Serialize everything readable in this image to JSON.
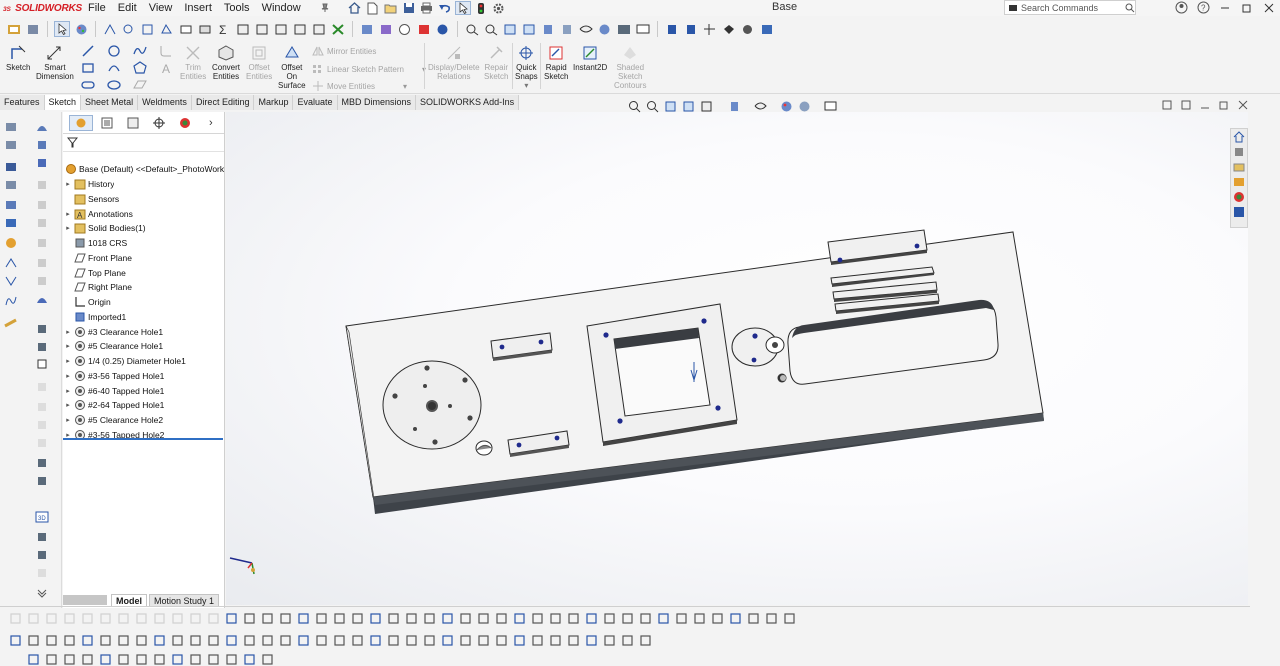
{
  "app": {
    "brand": "SOLIDWORKS",
    "document_title": "Base",
    "menu": [
      "File",
      "Edit",
      "View",
      "Insert",
      "Tools",
      "Window"
    ],
    "search_placeholder": "Search Commands"
  },
  "command_manager": {
    "sketch": "Sketch",
    "smart_dimension": [
      "Smart",
      "Dimension"
    ],
    "trim_entities": [
      "Trim",
      "Entities"
    ],
    "convert_entities": [
      "Convert",
      "Entities"
    ],
    "offset_entities": [
      "Offset",
      "Entities"
    ],
    "offset_on_surface": [
      "Offset",
      "On",
      "Surface"
    ],
    "mirror_entities": "Mirror Entities",
    "linear_sketch_pattern": "Linear Sketch Pattern",
    "move_entities": "Move Entities",
    "display_delete_relations": [
      "Display/Delete",
      "Relations"
    ],
    "repair_sketch": [
      "Repair",
      "Sketch"
    ],
    "quick_snaps": [
      "Quick",
      "Snaps"
    ],
    "rapid_sketch": [
      "Rapid",
      "Sketch"
    ],
    "instant2d": "Instant2D",
    "shaded_sketch_contours": [
      "Shaded",
      "Sketch",
      "Contours"
    ]
  },
  "tabs": [
    "Features",
    "Sketch",
    "Sheet Metal",
    "Weldments",
    "Direct Editing",
    "Markup",
    "Evaluate",
    "MBD Dimensions",
    "SOLIDWORKS Add-Ins"
  ],
  "active_tab": "Sketch",
  "feature_tree": {
    "root": "Base (Default) <<Default>_PhotoWorks Di",
    "items": [
      {
        "label": "History",
        "expandable": true,
        "icon": "history-icon"
      },
      {
        "label": "Sensors",
        "expandable": false,
        "icon": "sensors-icon"
      },
      {
        "label": "Annotations",
        "expandable": true,
        "icon": "annotations-icon"
      },
      {
        "label": "Solid Bodies(1)",
        "expandable": true,
        "icon": "solid-bodies-icon"
      },
      {
        "label": "1018 CRS",
        "expandable": false,
        "icon": "material-icon"
      },
      {
        "label": "Front Plane",
        "expandable": false,
        "icon": "plane-icon"
      },
      {
        "label": "Top Plane",
        "expandable": false,
        "icon": "plane-icon"
      },
      {
        "label": "Right Plane",
        "expandable": false,
        "icon": "plane-icon"
      },
      {
        "label": "Origin",
        "expandable": false,
        "icon": "origin-icon"
      },
      {
        "label": "Imported1",
        "expandable": false,
        "icon": "imported-body-icon"
      },
      {
        "label": "#3 Clearance Hole1",
        "expandable": true,
        "icon": "hole-wizard-icon"
      },
      {
        "label": "#5 Clearance Hole1",
        "expandable": true,
        "icon": "hole-wizard-icon"
      },
      {
        "label": "1/4 (0.25) Diameter Hole1",
        "expandable": true,
        "icon": "hole-wizard-icon"
      },
      {
        "label": "#3-56 Tapped Hole1",
        "expandable": true,
        "icon": "hole-wizard-icon"
      },
      {
        "label": "#6-40 Tapped Hole1",
        "expandable": true,
        "icon": "hole-wizard-icon"
      },
      {
        "label": "#2-64 Tapped Hole1",
        "expandable": true,
        "icon": "hole-wizard-icon"
      },
      {
        "label": "#5 Clearance Hole2",
        "expandable": true,
        "icon": "hole-wizard-icon"
      },
      {
        "label": "#3-56 Tapped Hole2",
        "expandable": true,
        "icon": "hole-wizard-icon"
      }
    ]
  },
  "bottom_tabs": [
    "Model",
    "Motion Study 1"
  ],
  "active_bottom_tab": "Model",
  "colors": {
    "brand_red": "#d51f26",
    "accent_blue": "#2f6fc4",
    "part_face": "#f2f2f2",
    "part_edge": "#2b2b2b",
    "part_side": "#555a60",
    "hole_point": "#1f2a8c"
  }
}
